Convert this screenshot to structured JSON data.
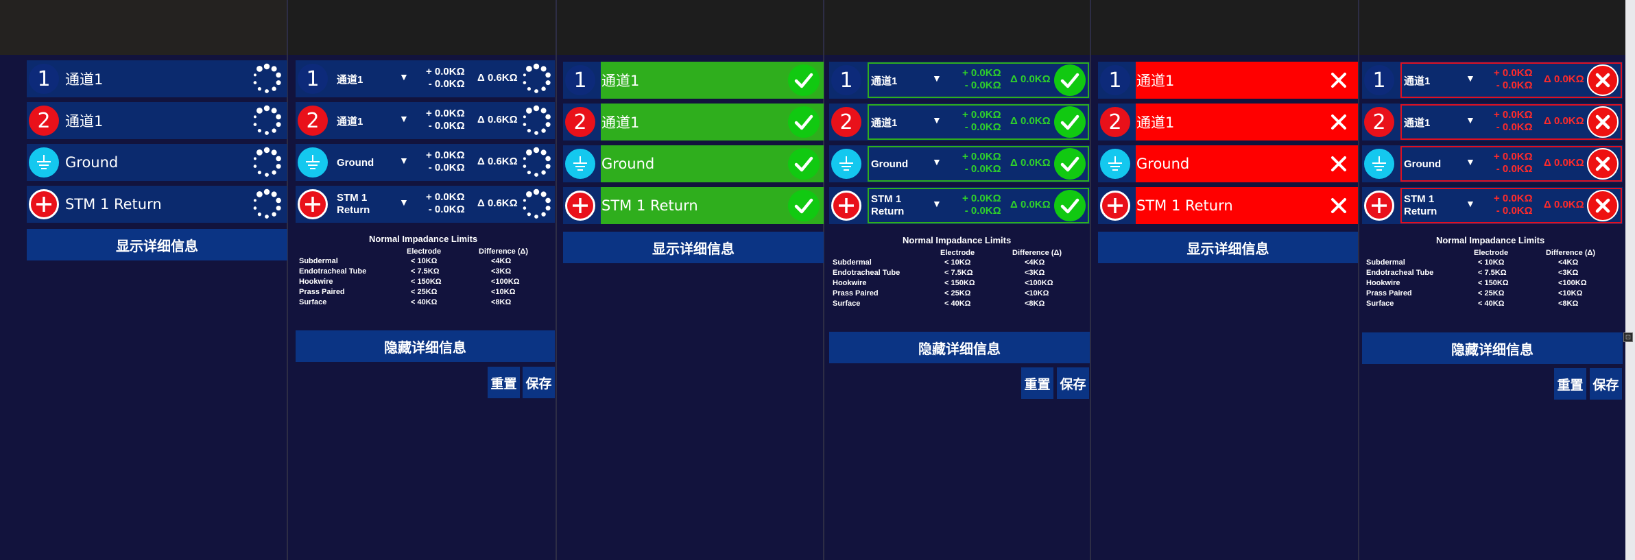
{
  "channels": [
    {
      "num": "1",
      "label": "通道1",
      "icon": "number-one-icon"
    },
    {
      "num": "2",
      "label": "通道1",
      "icon": "number-two-icon"
    },
    {
      "num": "",
      "label": "Ground",
      "icon": "ground-icon"
    },
    {
      "num": "+",
      "label": "STM 1 Return",
      "label_line1": "STM 1",
      "label_line2": "Return",
      "icon": "plus-icon"
    }
  ],
  "impedance": {
    "plus": "+ 0.0KΩ",
    "minus": "- 0.0KΩ",
    "delta_pending": "Δ 0.6KΩ",
    "delta_done": "Δ 0.0KΩ"
  },
  "buttons": {
    "show_details": "显示详细信息",
    "hide_details": "隐藏详细信息",
    "reset": "重置",
    "save": "保存"
  },
  "limits": {
    "title": "Normal Impadance Limits",
    "col_electrode": "Electrode",
    "col_difference": "Difference  (Δ)",
    "rows": [
      {
        "name": "Subdermal",
        "electrode": "< 10KΩ",
        "difference": "<4KΩ"
      },
      {
        "name": "Endotracheal Tube",
        "electrode": "< 7.5KΩ",
        "difference": "<3KΩ"
      },
      {
        "name": "Hookwire",
        "electrode": "< 150KΩ",
        "difference": "<100KΩ"
      },
      {
        "name": "Prass Paired",
        "electrode": "< 25KΩ",
        "difference": "<10KΩ"
      },
      {
        "name": "Surface",
        "electrode": "< 40KΩ",
        "difference": "<8KΩ"
      }
    ]
  },
  "colors": {
    "background": "#12133d",
    "row_bg": "#0b2a6e",
    "button_bg": "#0b3484",
    "pass_green": "#2fae1d",
    "fail_red": "#ff0000",
    "ok_text_green": "#2fd12a",
    "err_text_red": "#ff2a2a"
  },
  "scroll_glyph": "⊡"
}
